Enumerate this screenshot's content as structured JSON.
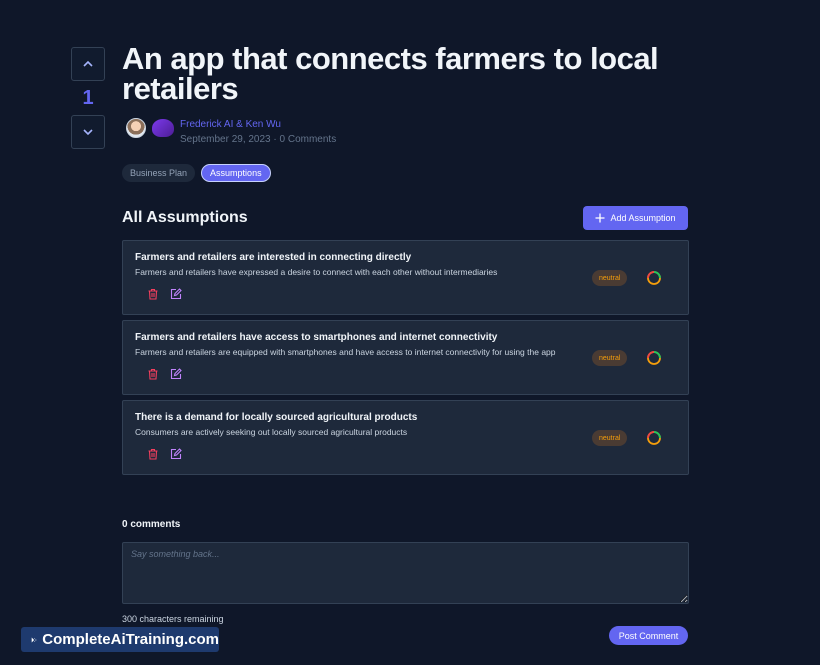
{
  "post": {
    "title": "An app that connects farmers to local retailers",
    "authors": "Frederick AI & Ken Wu",
    "date_line": "September 29, 2023 · 0 Comments",
    "votes": "1",
    "vote_up_icon": "chevron-up-icon",
    "vote_down_icon": "chevron-down-icon"
  },
  "tabs": [
    {
      "label": "Business Plan",
      "active": false
    },
    {
      "label": "Assumptions",
      "active": true
    }
  ],
  "assumptions_section": {
    "title": "All Assumptions",
    "add_button_label": "Add Assumption"
  },
  "assumptions": [
    {
      "title": "Farmers and retailers are interested in connecting directly",
      "description": "Farmers and retailers have expressed a desire to connect with each other without intermediaries",
      "status": "neutral"
    },
    {
      "title": "Farmers and retailers have access to smartphones and internet connectivity",
      "description": "Farmers and retailers are equipped with smartphones and have access to internet connectivity for using the app",
      "status": "neutral"
    },
    {
      "title": "There is a demand for locally sourced agricultural products",
      "description": "Consumers are actively seeking out locally sourced agricultural products",
      "status": "neutral"
    }
  ],
  "comments": {
    "title": "0 comments",
    "placeholder": "Say something back...",
    "remaining": "300 characters remaining",
    "post_button_label": "Post Comment"
  },
  "watermark": {
    "text": "CompleteAiTraining.com"
  },
  "colors": {
    "background": "#0f1729",
    "accent": "#6366f1",
    "card": "#1e293b",
    "delete_icon": "#f43f5e",
    "edit_icon": "#c084fc",
    "neutral_badge_text": "#f59e0b"
  }
}
